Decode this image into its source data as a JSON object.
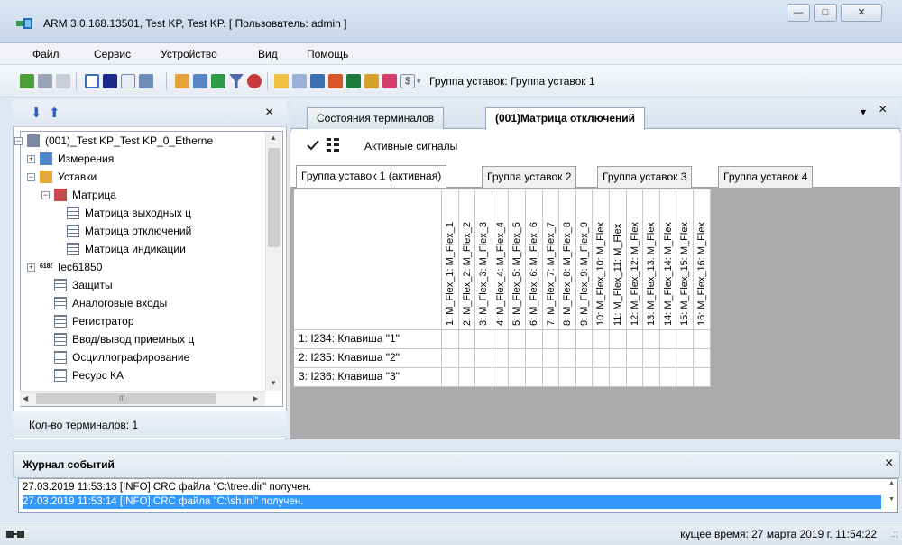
{
  "window": {
    "title": "ARM 3.0.168.13501, Test KP, Test KP. [ Пользователь: admin ]",
    "min_label": "—",
    "max_label": "□",
    "close_label": "✕"
  },
  "menu": [
    {
      "label": "Файл"
    },
    {
      "label": "Сервис"
    },
    {
      "label": "Устройство"
    },
    {
      "label": "Вид"
    },
    {
      "label": "Помощь"
    }
  ],
  "toolbar": {
    "group_label": "Группа уставок: Группа уставок 1",
    "dollar_label": "$"
  },
  "left_panel": {
    "down_arrow": "⬇",
    "up_arrow": "⬆",
    "close_label": "×",
    "footer": "Кол-во терминалов: 1",
    "scroll_up": "▲",
    "scroll_down": "▼",
    "scroll_left": "◀",
    "scroll_right": "▶",
    "thumb_grip": "III",
    "tree": [
      {
        "label": "(001)_Test KP_Test KP_0_Etherne",
        "icon": "device-icon",
        "expander": "−"
      },
      {
        "label": "Измерения",
        "icon": "measure-icon",
        "expander": "+"
      },
      {
        "label": "Уставки",
        "icon": "folder-icon",
        "expander": "−"
      },
      {
        "label": "Матрица",
        "icon": "matrix-icon",
        "expander": "−"
      },
      {
        "label": "Матрица выходных ц",
        "icon": "table-icon"
      },
      {
        "label": "Матрица отключений",
        "icon": "table-icon"
      },
      {
        "label": "Матрица индикации",
        "icon": "table-icon"
      },
      {
        "label": "Iec61850",
        "icon": "iec-icon",
        "icon_text": "61850",
        "expander": "+"
      },
      {
        "label": "Защиты",
        "icon": "table-icon"
      },
      {
        "label": "Аналоговые входы",
        "icon": "table-icon"
      },
      {
        "label": "Регистратор",
        "icon": "table-icon"
      },
      {
        "label": "Ввод/вывод приемных ц",
        "icon": "table-icon"
      },
      {
        "label": "Осциллографирование",
        "icon": "table-icon"
      },
      {
        "label": "Ресурс КА",
        "icon": "table-icon"
      }
    ]
  },
  "tabs": {
    "items": [
      {
        "label": "Состояния терминалов"
      },
      {
        "label": "(001)Матрица отключений"
      }
    ],
    "dropdown_label": "▾",
    "close_label": "×"
  },
  "active_signals": {
    "label": "Активные сигналы"
  },
  "setting_groups": [
    {
      "label": "Группа уставок 1 (активная)"
    },
    {
      "label": "Группа уставок 2"
    },
    {
      "label": "Группа уставок 3"
    },
    {
      "label": "Группа уставок 4"
    }
  ],
  "matrix": {
    "columns": [
      "1: M_Flex_1: M_Flex_1",
      "2: M_Flex_2: M_Flex_2",
      "3: M_Flex_3: M_Flex_3",
      "4: M_Flex_4: M_Flex_4",
      "5: M_Flex_5: M_Flex_5",
      "6: M_Flex_6: M_Flex_6",
      "7: M_Flex_7: M_Flex_7",
      "8: M_Flex_8: M_Flex_8",
      "9: M_Flex_9: M_Flex_9",
      "10: M_Flex_10: M_Flex",
      "11: M_Flex_11: M_Flex",
      "12: M_Flex_12: M_Flex",
      "13: M_Flex_13: M_Flex",
      "14: M_Flex_14: M_Flex",
      "15: M_Flex_15: M_Flex",
      "16: M_Flex_16: M_Flex"
    ],
    "rows": [
      {
        "label": "1: I234:  Клавиша \"1\""
      },
      {
        "label": "2: I235:  Клавиша \"2\""
      },
      {
        "label": "3: I236:  Клавиша \"3\""
      }
    ]
  },
  "event_log": {
    "title": "Журнал событий",
    "close_label": "×",
    "scroll_up": "▲",
    "scroll_down": "▼",
    "entries": [
      {
        "text": "27.03.2019 11:53:13 [INFO] CRC файла \"C:\\tree.dir\" получен."
      },
      {
        "text": "27.03.2019 11:53:14 [INFO] CRC файла \"C:\\sh.ini\" получен."
      }
    ],
    "selected_color": "#3399ff"
  },
  "status_bar": {
    "text": "кущее время: 27 марта 2019 г. 11:54:22",
    "grip": ".:;"
  }
}
